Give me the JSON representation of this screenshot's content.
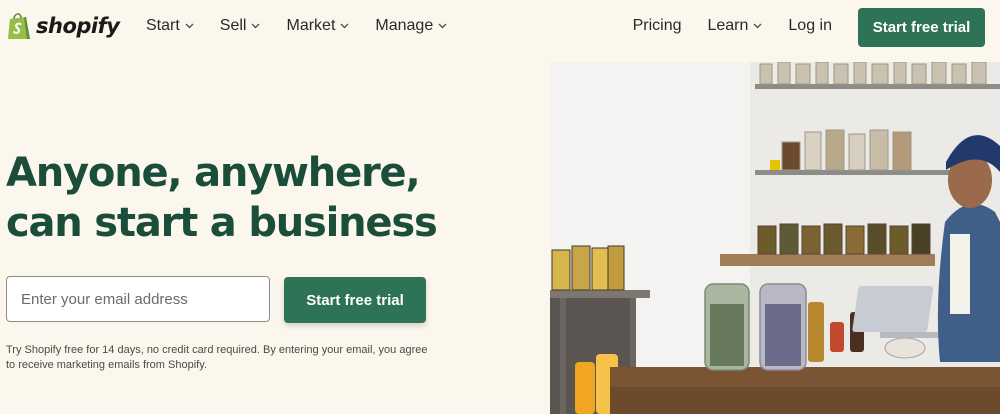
{
  "brand": {
    "name": "shopify",
    "accent": "#2f7356",
    "headline_color": "#1a4d3a"
  },
  "nav": {
    "left_items": [
      {
        "label": "Start",
        "has_dropdown": true
      },
      {
        "label": "Sell",
        "has_dropdown": true
      },
      {
        "label": "Market",
        "has_dropdown": true
      },
      {
        "label": "Manage",
        "has_dropdown": true
      }
    ],
    "right_items": [
      {
        "label": "Pricing",
        "has_dropdown": false
      },
      {
        "label": "Learn",
        "has_dropdown": true
      },
      {
        "label": "Log in",
        "has_dropdown": false
      }
    ],
    "cta_label": "Start free trial"
  },
  "hero": {
    "headline_line1": "Anyone, anywhere,",
    "headline_line2": "can start a business",
    "email_placeholder": "Enter your email address",
    "cta_label": "Start free trial",
    "disclaimer": "Try Shopify free for 14 days, no credit card required. By entering your email, you agree to receive marketing emails from Shopify."
  }
}
